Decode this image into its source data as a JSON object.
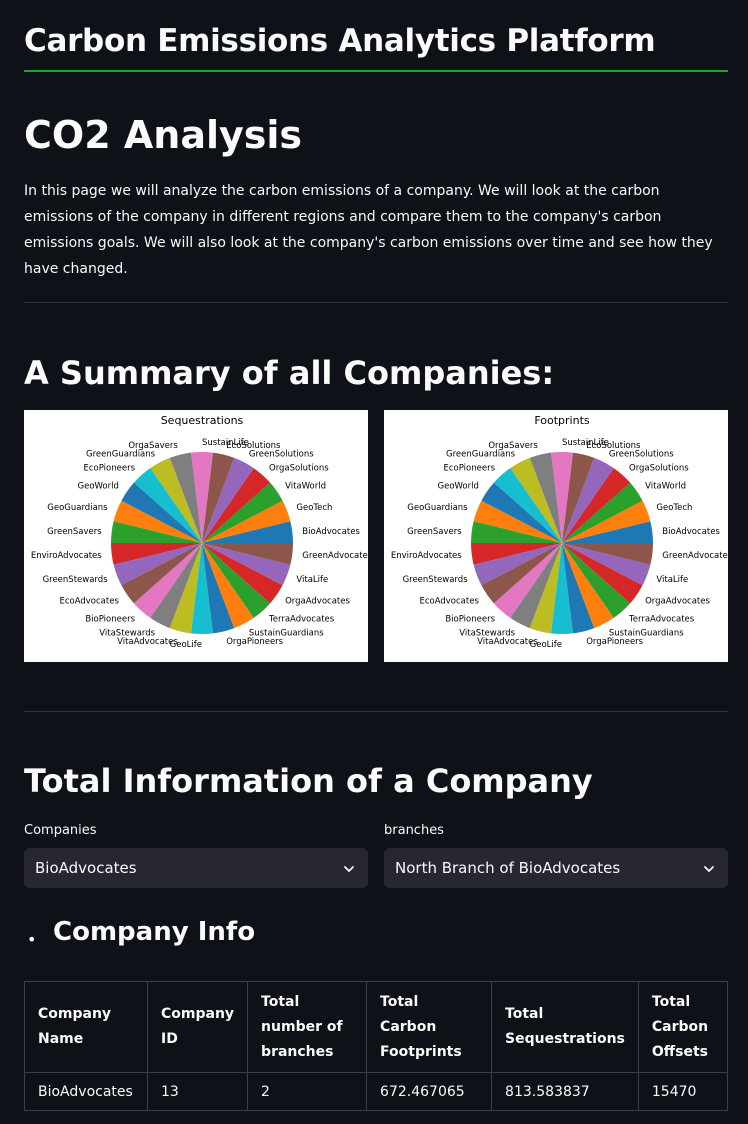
{
  "app_title": "Carbon Emissions Analytics Platform",
  "page_title": "CO2 Analysis",
  "intro_text": "In this page we will analyze the carbon emissions of a company. We will look at the carbon emissions of the company in different regions and compare them to the company's carbon emissions goals. We will also look at the company's carbon emissions over time and see how they have changed.",
  "summary_heading": "A Summary of all Companies:",
  "colors": [
    "#1f77b4",
    "#ff7f0e",
    "#2ca02c",
    "#d62728",
    "#9467bd",
    "#8c564b",
    "#e377c2",
    "#7f7f7f",
    "#bcbd22",
    "#17becf"
  ],
  "chart_data": [
    {
      "type": "pie",
      "title": "Sequestrations",
      "categories": [
        "BioAdvocates",
        "GeoTech",
        "VitaWorld",
        "OrgaSolutions",
        "GreenSolutions",
        "EcoSolutions",
        "SustainLife",
        "OrgaSavers",
        "GreenGuardians",
        "EcoPioneers",
        "GeoWorld",
        "GeoGuardians",
        "GreenSavers",
        "EnviroAdvocates",
        "GreenStewards",
        "EcoAdvocates",
        "BioPioneers",
        "VitaStewards",
        "VitaAdvocates",
        "GeoLife",
        "OrgaPioneers",
        "SustainGuardians",
        "TerraAdvocates",
        "OrgaAdvocates",
        "VitaLife",
        "GreenAdvocates"
      ],
      "values": [
        1,
        1,
        1,
        1,
        1,
        1,
        1,
        1,
        1,
        1,
        1,
        1,
        1,
        1,
        1,
        1,
        1,
        1,
        1,
        1,
        1,
        1,
        1,
        1,
        1,
        1
      ]
    },
    {
      "type": "pie",
      "title": "Footprints",
      "categories": [
        "BioAdvocates",
        "GeoTech",
        "VitaWorld",
        "OrgaSolutions",
        "GreenSolutions",
        "EcoSolutions",
        "SustainLife",
        "OrgaSavers",
        "GreenGuardians",
        "EcoPioneers",
        "GeoWorld",
        "GeoGuardians",
        "GreenSavers",
        "EnviroAdvocates",
        "GreenStewards",
        "EcoAdvocates",
        "BioPioneers",
        "VitaStewards",
        "VitaAdvocates",
        "GeoLife",
        "OrgaPioneers",
        "SustainGuardians",
        "TerraAdvocates",
        "OrgaAdvocates",
        "VitaLife",
        "GreenAdvocates"
      ],
      "values": [
        1,
        1,
        1,
        1,
        1,
        1,
        1,
        1,
        1,
        1,
        1,
        1,
        1,
        1,
        1,
        1,
        1,
        1,
        1,
        1,
        1,
        1,
        1,
        1,
        1,
        1
      ]
    }
  ],
  "total_heading": "Total Information of a Company",
  "companies_select": {
    "label": "Companies",
    "value": "BioAdvocates"
  },
  "branches_select": {
    "label": "branches",
    "value": "North Branch of BioAdvocates"
  },
  "bullet_char": "•",
  "company_info_heading": "Company Info",
  "table": {
    "headers": [
      "Company Name",
      "Company ID",
      "Total number of branches",
      "Total Carbon Footprints",
      "Total Sequestrations",
      "Total Carbon Offsets"
    ],
    "rows": [
      [
        "BioAdvocates",
        "13",
        "2",
        "672.467065",
        "813.583837",
        "15470"
      ]
    ]
  }
}
